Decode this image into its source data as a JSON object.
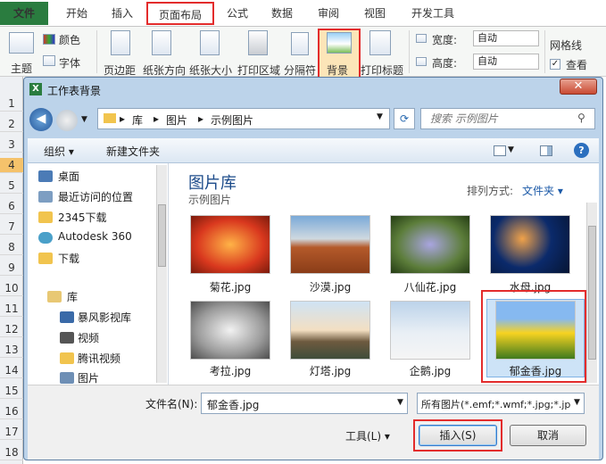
{
  "ribbon": {
    "tabs": [
      "文件",
      "开始",
      "插入",
      "页面布局",
      "公式",
      "数据",
      "审阅",
      "视图",
      "开发工具"
    ],
    "groups": {
      "theme": "主题",
      "colors": "颜色",
      "fonts": "字体",
      "margins": "页边距",
      "orientation": "纸张方向",
      "size": "纸张大小",
      "print_area": "打印区域",
      "breaks": "分隔符",
      "background": "背景",
      "print_titles": "打印标题",
      "width_label": "宽度:",
      "height_label": "高度:",
      "width_value": "自动",
      "height_value": "自动",
      "gridlines": "网格线",
      "view": "查看"
    }
  },
  "rows": [
    "1",
    "2",
    "3",
    "4",
    "5",
    "6",
    "7",
    "8",
    "9",
    "10",
    "11",
    "12",
    "13",
    "14",
    "15",
    "16",
    "17",
    "18"
  ],
  "dialog": {
    "title": "工作表背景",
    "breadcrumb": [
      "库",
      "图片",
      "示例图片"
    ],
    "search_placeholder": "搜索 示例图片",
    "organize": "组织 ▾",
    "new_folder": "新建文件夹",
    "library_title": "图片库",
    "library_subtitle": "示例图片",
    "sort_label": "排列方式:",
    "sort_value": "文件夹 ▾",
    "nav": [
      "桌面",
      "最近访问的位置",
      "2345下载",
      "Autodesk 360",
      "下载",
      "库",
      "暴风影视库",
      "视频",
      "腾讯视频",
      "图片"
    ],
    "files": [
      "菊花.jpg",
      "沙漠.jpg",
      "八仙花.jpg",
      "水母.jpg",
      "考拉.jpg",
      "灯塔.jpg",
      "企鹅.jpg",
      "郁金香.jpg"
    ],
    "filename_label": "文件名(N):",
    "filename_value": "郁金香.jpg",
    "filter": "所有图片(*.emf;*.wmf;*.jpg;*.jp",
    "tools": "工具(L)  ▾",
    "insert": "插入(S)",
    "cancel": "取消"
  },
  "colors": {
    "excel_green": "#2a7c3f",
    "highlight": "#e32c2c"
  }
}
